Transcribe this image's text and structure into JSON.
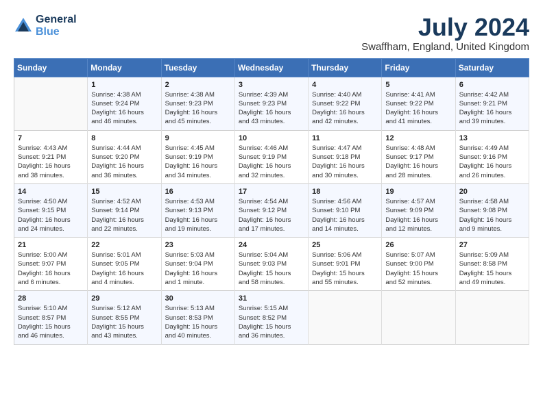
{
  "header": {
    "logo_line1": "General",
    "logo_line2": "Blue",
    "month_year": "July 2024",
    "location": "Swaffham, England, United Kingdom"
  },
  "days_of_week": [
    "Sunday",
    "Monday",
    "Tuesday",
    "Wednesday",
    "Thursday",
    "Friday",
    "Saturday"
  ],
  "weeks": [
    [
      {
        "day": "",
        "text": ""
      },
      {
        "day": "1",
        "text": "Sunrise: 4:38 AM\nSunset: 9:24 PM\nDaylight: 16 hours\nand 46 minutes."
      },
      {
        "day": "2",
        "text": "Sunrise: 4:38 AM\nSunset: 9:23 PM\nDaylight: 16 hours\nand 45 minutes."
      },
      {
        "day": "3",
        "text": "Sunrise: 4:39 AM\nSunset: 9:23 PM\nDaylight: 16 hours\nand 43 minutes."
      },
      {
        "day": "4",
        "text": "Sunrise: 4:40 AM\nSunset: 9:22 PM\nDaylight: 16 hours\nand 42 minutes."
      },
      {
        "day": "5",
        "text": "Sunrise: 4:41 AM\nSunset: 9:22 PM\nDaylight: 16 hours\nand 41 minutes."
      },
      {
        "day": "6",
        "text": "Sunrise: 4:42 AM\nSunset: 9:21 PM\nDaylight: 16 hours\nand 39 minutes."
      }
    ],
    [
      {
        "day": "7",
        "text": "Sunrise: 4:43 AM\nSunset: 9:21 PM\nDaylight: 16 hours\nand 38 minutes."
      },
      {
        "day": "8",
        "text": "Sunrise: 4:44 AM\nSunset: 9:20 PM\nDaylight: 16 hours\nand 36 minutes."
      },
      {
        "day": "9",
        "text": "Sunrise: 4:45 AM\nSunset: 9:19 PM\nDaylight: 16 hours\nand 34 minutes."
      },
      {
        "day": "10",
        "text": "Sunrise: 4:46 AM\nSunset: 9:19 PM\nDaylight: 16 hours\nand 32 minutes."
      },
      {
        "day": "11",
        "text": "Sunrise: 4:47 AM\nSunset: 9:18 PM\nDaylight: 16 hours\nand 30 minutes."
      },
      {
        "day": "12",
        "text": "Sunrise: 4:48 AM\nSunset: 9:17 PM\nDaylight: 16 hours\nand 28 minutes."
      },
      {
        "day": "13",
        "text": "Sunrise: 4:49 AM\nSunset: 9:16 PM\nDaylight: 16 hours\nand 26 minutes."
      }
    ],
    [
      {
        "day": "14",
        "text": "Sunrise: 4:50 AM\nSunset: 9:15 PM\nDaylight: 16 hours\nand 24 minutes."
      },
      {
        "day": "15",
        "text": "Sunrise: 4:52 AM\nSunset: 9:14 PM\nDaylight: 16 hours\nand 22 minutes."
      },
      {
        "day": "16",
        "text": "Sunrise: 4:53 AM\nSunset: 9:13 PM\nDaylight: 16 hours\nand 19 minutes."
      },
      {
        "day": "17",
        "text": "Sunrise: 4:54 AM\nSunset: 9:12 PM\nDaylight: 16 hours\nand 17 minutes."
      },
      {
        "day": "18",
        "text": "Sunrise: 4:56 AM\nSunset: 9:10 PM\nDaylight: 16 hours\nand 14 minutes."
      },
      {
        "day": "19",
        "text": "Sunrise: 4:57 AM\nSunset: 9:09 PM\nDaylight: 16 hours\nand 12 minutes."
      },
      {
        "day": "20",
        "text": "Sunrise: 4:58 AM\nSunset: 9:08 PM\nDaylight: 16 hours\nand 9 minutes."
      }
    ],
    [
      {
        "day": "21",
        "text": "Sunrise: 5:00 AM\nSunset: 9:07 PM\nDaylight: 16 hours\nand 6 minutes."
      },
      {
        "day": "22",
        "text": "Sunrise: 5:01 AM\nSunset: 9:05 PM\nDaylight: 16 hours\nand 4 minutes."
      },
      {
        "day": "23",
        "text": "Sunrise: 5:03 AM\nSunset: 9:04 PM\nDaylight: 16 hours\nand 1 minute."
      },
      {
        "day": "24",
        "text": "Sunrise: 5:04 AM\nSunset: 9:03 PM\nDaylight: 15 hours\nand 58 minutes."
      },
      {
        "day": "25",
        "text": "Sunrise: 5:06 AM\nSunset: 9:01 PM\nDaylight: 15 hours\nand 55 minutes."
      },
      {
        "day": "26",
        "text": "Sunrise: 5:07 AM\nSunset: 9:00 PM\nDaylight: 15 hours\nand 52 minutes."
      },
      {
        "day": "27",
        "text": "Sunrise: 5:09 AM\nSunset: 8:58 PM\nDaylight: 15 hours\nand 49 minutes."
      }
    ],
    [
      {
        "day": "28",
        "text": "Sunrise: 5:10 AM\nSunset: 8:57 PM\nDaylight: 15 hours\nand 46 minutes."
      },
      {
        "day": "29",
        "text": "Sunrise: 5:12 AM\nSunset: 8:55 PM\nDaylight: 15 hours\nand 43 minutes."
      },
      {
        "day": "30",
        "text": "Sunrise: 5:13 AM\nSunset: 8:53 PM\nDaylight: 15 hours\nand 40 minutes."
      },
      {
        "day": "31",
        "text": "Sunrise: 5:15 AM\nSunset: 8:52 PM\nDaylight: 15 hours\nand 36 minutes."
      },
      {
        "day": "",
        "text": ""
      },
      {
        "day": "",
        "text": ""
      },
      {
        "day": "",
        "text": ""
      }
    ]
  ]
}
